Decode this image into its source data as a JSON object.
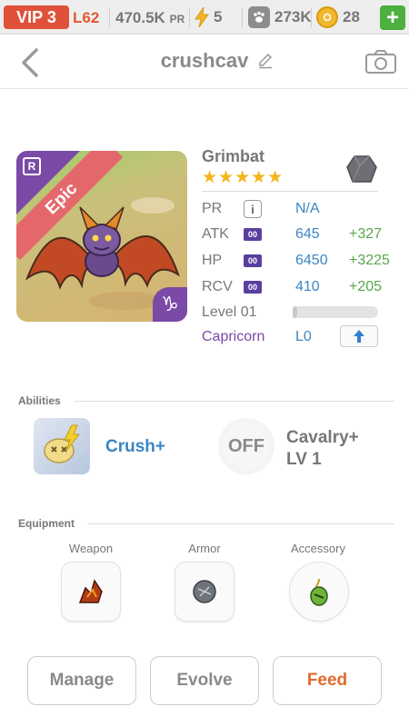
{
  "topbar": {
    "vip": "VIP 3",
    "level": "L62",
    "power": "470.5K",
    "power_unit": "PR",
    "energy": "5",
    "paws": "273K",
    "coins": "28",
    "add": "+"
  },
  "header": {
    "title": "crushcav"
  },
  "monster": {
    "name": "Grimbat",
    "rarity": "Epic",
    "rank_badge": "R",
    "zodiac_symbol": "♑",
    "stars": "★★★★★",
    "stats": [
      {
        "label": "PR",
        "value": "N/A",
        "bonus": ""
      },
      {
        "label": "ATK",
        "tag": "00",
        "value": "645",
        "bonus": "+327"
      },
      {
        "label": "HP",
        "tag": "00",
        "value": "6450",
        "bonus": "+3225"
      },
      {
        "label": "RCV",
        "tag": "00",
        "value": "410",
        "bonus": "+205"
      }
    ],
    "level": "Level 01",
    "level_progress": 0.05,
    "zodiac_name": "Capricorn",
    "zodiac_level": "L0"
  },
  "abilities": {
    "label": "Abilities",
    "items": [
      {
        "name": "Crush+"
      },
      {
        "status": "OFF",
        "name_line1": "Cavalry+",
        "name_line2": "LV 1"
      }
    ]
  },
  "equipment": {
    "label": "Equipment",
    "slots": [
      "Weapon",
      "Armor",
      "Accessory"
    ]
  },
  "actions": {
    "manage": "Manage",
    "evolve": "Evolve",
    "feed": "Feed"
  }
}
